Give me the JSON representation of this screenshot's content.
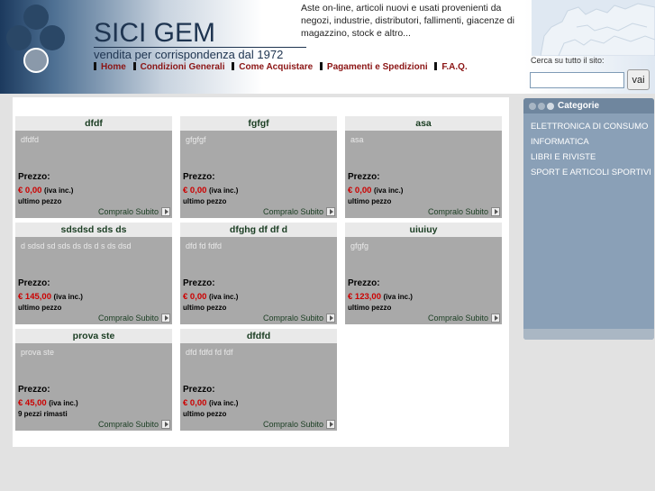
{
  "brand": {
    "name": "SICI GEM",
    "tagline": "vendita per corrispondenza dal 1972"
  },
  "intro": "Aste on-line, articoli nuovi e usati provenienti da negozi, industrie, distributori, fallimenti, giacenze di magazzino, stock e altro...",
  "nav": [
    "Home",
    "Condizioni Generali",
    "Come Acquistare",
    "Pagamenti e Spedizioni",
    "F.A.Q."
  ],
  "search": {
    "label": "Cerca su tutto il sito:",
    "value": "",
    "button": "vai"
  },
  "sidebar": {
    "title": "Categorie",
    "items": [
      "ELETTRONICA DI CONSUMO",
      "INFORMATICA",
      "LIBRI E RIVISTE",
      "SPORT E ARTICOLI SPORTIVI"
    ]
  },
  "product_labels": {
    "price_label": "Prezzo:",
    "iva": "(iva inc.)",
    "buy": "Compralo Subito"
  },
  "products": [
    {
      "title": "dfdf",
      "desc": "dfdfd",
      "price": "€ 0,00",
      "stock": "ultimo pezzo"
    },
    {
      "title": "fgfgf",
      "desc": "gfgfgf",
      "price": "€ 0,00",
      "stock": "ultimo pezzo"
    },
    {
      "title": "asa",
      "desc": "asa",
      "price": "€ 0,00",
      "stock": "ultimo pezzo"
    },
    {
      "title": "sdsdsd sds ds",
      "desc": "d sdsd sd sds ds ds d s ds dsd",
      "price": "€ 145,00",
      "stock": "ultimo pezzo"
    },
    {
      "title": "dfghg df df d",
      "desc": "dfd fd fdfd",
      "price": "€ 0,00",
      "stock": "ultimo pezzo"
    },
    {
      "title": "uiuiuy",
      "desc": "gfgfg",
      "price": "€ 123,00",
      "stock": "ultimo pezzo"
    },
    {
      "title": "prova ste",
      "desc": "prova ste",
      "price": "€ 45,00",
      "stock": "9 pezzi rimasti"
    },
    {
      "title": "dfdfd",
      "desc": "dfd fdfd fd fdf",
      "price": "€ 0,00",
      "stock": "ultimo pezzo"
    }
  ],
  "colors": {
    "nav_link": "#8b1414",
    "price": "#cc0000",
    "card_bg": "#a9a9a9",
    "sidebar_bg": "#8aa0b7",
    "brand": "#1e3450"
  }
}
